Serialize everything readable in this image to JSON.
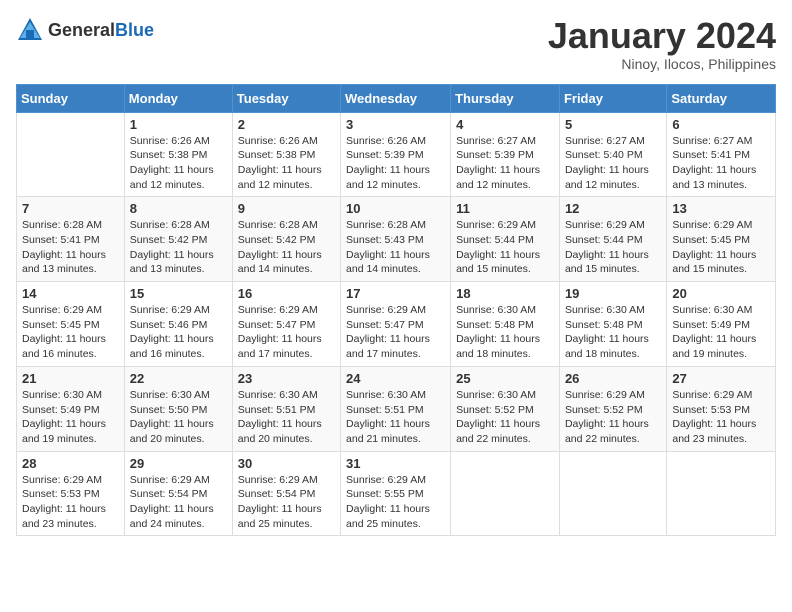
{
  "header": {
    "logo_general": "General",
    "logo_blue": "Blue",
    "month_title": "January 2024",
    "location": "Ninoy, Ilocos, Philippines"
  },
  "calendar": {
    "days_of_week": [
      "Sunday",
      "Monday",
      "Tuesday",
      "Wednesday",
      "Thursday",
      "Friday",
      "Saturday"
    ],
    "weeks": [
      [
        {
          "num": "",
          "info": ""
        },
        {
          "num": "1",
          "info": "Sunrise: 6:26 AM\nSunset: 5:38 PM\nDaylight: 11 hours\nand 12 minutes."
        },
        {
          "num": "2",
          "info": "Sunrise: 6:26 AM\nSunset: 5:38 PM\nDaylight: 11 hours\nand 12 minutes."
        },
        {
          "num": "3",
          "info": "Sunrise: 6:26 AM\nSunset: 5:39 PM\nDaylight: 11 hours\nand 12 minutes."
        },
        {
          "num": "4",
          "info": "Sunrise: 6:27 AM\nSunset: 5:39 PM\nDaylight: 11 hours\nand 12 minutes."
        },
        {
          "num": "5",
          "info": "Sunrise: 6:27 AM\nSunset: 5:40 PM\nDaylight: 11 hours\nand 12 minutes."
        },
        {
          "num": "6",
          "info": "Sunrise: 6:27 AM\nSunset: 5:41 PM\nDaylight: 11 hours\nand 13 minutes."
        }
      ],
      [
        {
          "num": "7",
          "info": "Sunrise: 6:28 AM\nSunset: 5:41 PM\nDaylight: 11 hours\nand 13 minutes."
        },
        {
          "num": "8",
          "info": "Sunrise: 6:28 AM\nSunset: 5:42 PM\nDaylight: 11 hours\nand 13 minutes."
        },
        {
          "num": "9",
          "info": "Sunrise: 6:28 AM\nSunset: 5:42 PM\nDaylight: 11 hours\nand 14 minutes."
        },
        {
          "num": "10",
          "info": "Sunrise: 6:28 AM\nSunset: 5:43 PM\nDaylight: 11 hours\nand 14 minutes."
        },
        {
          "num": "11",
          "info": "Sunrise: 6:29 AM\nSunset: 5:44 PM\nDaylight: 11 hours\nand 15 minutes."
        },
        {
          "num": "12",
          "info": "Sunrise: 6:29 AM\nSunset: 5:44 PM\nDaylight: 11 hours\nand 15 minutes."
        },
        {
          "num": "13",
          "info": "Sunrise: 6:29 AM\nSunset: 5:45 PM\nDaylight: 11 hours\nand 15 minutes."
        }
      ],
      [
        {
          "num": "14",
          "info": "Sunrise: 6:29 AM\nSunset: 5:45 PM\nDaylight: 11 hours\nand 16 minutes."
        },
        {
          "num": "15",
          "info": "Sunrise: 6:29 AM\nSunset: 5:46 PM\nDaylight: 11 hours\nand 16 minutes."
        },
        {
          "num": "16",
          "info": "Sunrise: 6:29 AM\nSunset: 5:47 PM\nDaylight: 11 hours\nand 17 minutes."
        },
        {
          "num": "17",
          "info": "Sunrise: 6:29 AM\nSunset: 5:47 PM\nDaylight: 11 hours\nand 17 minutes."
        },
        {
          "num": "18",
          "info": "Sunrise: 6:30 AM\nSunset: 5:48 PM\nDaylight: 11 hours\nand 18 minutes."
        },
        {
          "num": "19",
          "info": "Sunrise: 6:30 AM\nSunset: 5:48 PM\nDaylight: 11 hours\nand 18 minutes."
        },
        {
          "num": "20",
          "info": "Sunrise: 6:30 AM\nSunset: 5:49 PM\nDaylight: 11 hours\nand 19 minutes."
        }
      ],
      [
        {
          "num": "21",
          "info": "Sunrise: 6:30 AM\nSunset: 5:49 PM\nDaylight: 11 hours\nand 19 minutes."
        },
        {
          "num": "22",
          "info": "Sunrise: 6:30 AM\nSunset: 5:50 PM\nDaylight: 11 hours\nand 20 minutes."
        },
        {
          "num": "23",
          "info": "Sunrise: 6:30 AM\nSunset: 5:51 PM\nDaylight: 11 hours\nand 20 minutes."
        },
        {
          "num": "24",
          "info": "Sunrise: 6:30 AM\nSunset: 5:51 PM\nDaylight: 11 hours\nand 21 minutes."
        },
        {
          "num": "25",
          "info": "Sunrise: 6:30 AM\nSunset: 5:52 PM\nDaylight: 11 hours\nand 22 minutes."
        },
        {
          "num": "26",
          "info": "Sunrise: 6:29 AM\nSunset: 5:52 PM\nDaylight: 11 hours\nand 22 minutes."
        },
        {
          "num": "27",
          "info": "Sunrise: 6:29 AM\nSunset: 5:53 PM\nDaylight: 11 hours\nand 23 minutes."
        }
      ],
      [
        {
          "num": "28",
          "info": "Sunrise: 6:29 AM\nSunset: 5:53 PM\nDaylight: 11 hours\nand 23 minutes."
        },
        {
          "num": "29",
          "info": "Sunrise: 6:29 AM\nSunset: 5:54 PM\nDaylight: 11 hours\nand 24 minutes."
        },
        {
          "num": "30",
          "info": "Sunrise: 6:29 AM\nSunset: 5:54 PM\nDaylight: 11 hours\nand 25 minutes."
        },
        {
          "num": "31",
          "info": "Sunrise: 6:29 AM\nSunset: 5:55 PM\nDaylight: 11 hours\nand 25 minutes."
        },
        {
          "num": "",
          "info": ""
        },
        {
          "num": "",
          "info": ""
        },
        {
          "num": "",
          "info": ""
        }
      ]
    ]
  }
}
